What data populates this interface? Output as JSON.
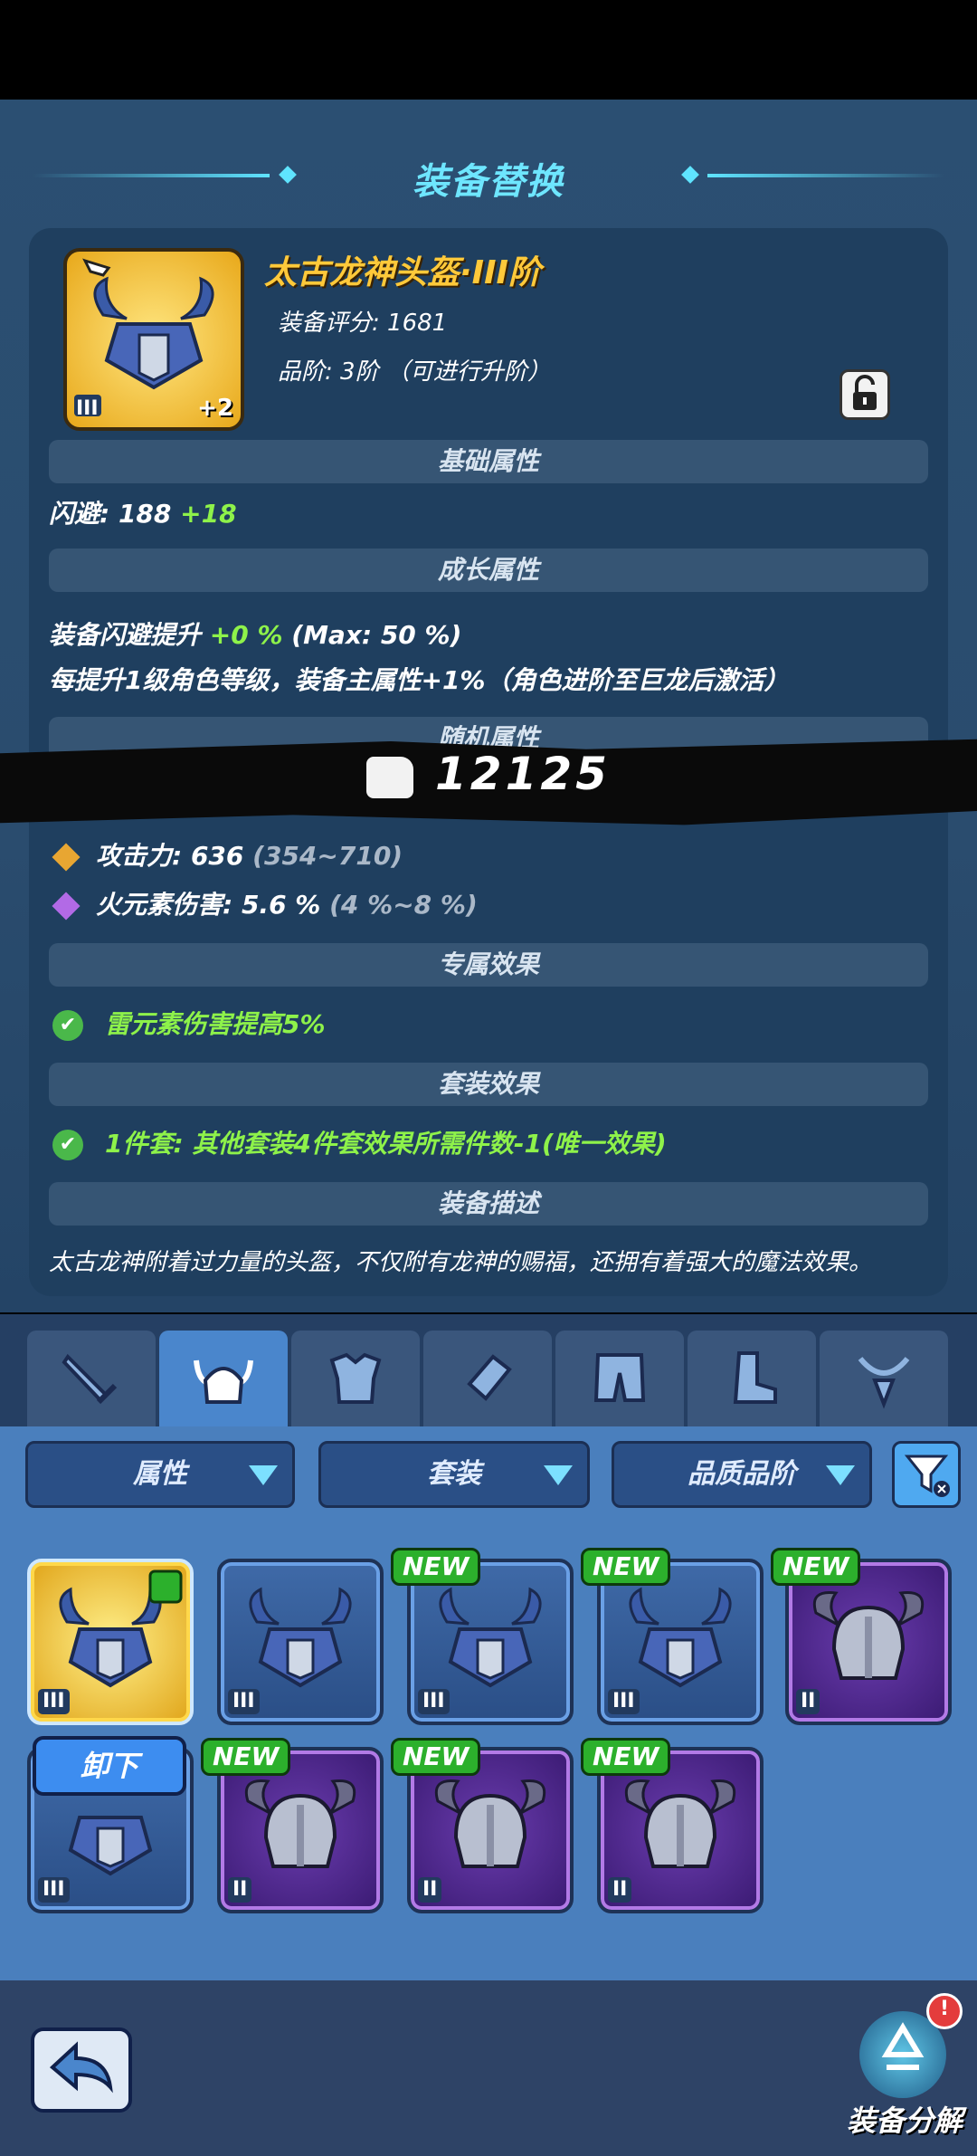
{
  "header": {
    "title": "装备替换"
  },
  "item": {
    "name": "太古龙神头盔·III阶",
    "score": "装备评分: 1681",
    "grade": "品阶: 3阶 （可进行升阶）",
    "tier": "III",
    "plus": "+2"
  },
  "sections": {
    "base": "基础属性",
    "growth": "成长属性",
    "random": "随机属性",
    "exclusive": "专属效果",
    "set": "套装效果",
    "desc": "装备描述"
  },
  "stats": {
    "dodge_label": "闪避: 188",
    "dodge_bonus": "+18",
    "growth_line1_a": "装备闪避提升",
    "growth_line1_b": "+0 %",
    "growth_line1_c": "(Max: 50 %)",
    "growth_line2": "每提升1级角色等级，装备主属性+1%（角色进阶至巨龙后激活）",
    "attack": "攻击力: 636",
    "attack_range": "(354~710)",
    "fire": "火元素伤害: 5.6 %",
    "fire_range": "(4 %~8 %)",
    "exclusive_effect": "雷元素伤害提高5%",
    "set_effect": "1件套: 其他套装4件套效果所需件数-1(唯一效果)",
    "description": "太古龙神附着过力量的头盔，不仅附有龙神的赐福，还拥有着强大的魔法效果。"
  },
  "power": "12125",
  "filters": [
    "属性",
    "套装",
    "品质品阶"
  ],
  "tabs": [
    "weapon",
    "helmet",
    "armor",
    "bracer",
    "pants",
    "boots",
    "necklace"
  ],
  "inventory": [
    {
      "tier": "III",
      "rarity": "gold",
      "new": false,
      "equipped": true
    },
    {
      "tier": "III",
      "rarity": "blue",
      "new": false
    },
    {
      "tier": "III",
      "rarity": "blue",
      "new": true
    },
    {
      "tier": "III",
      "rarity": "blue",
      "new": true
    },
    {
      "tier": "II",
      "rarity": "purple",
      "new": true
    },
    {
      "tier": "III",
      "rarity": "blue",
      "new": false
    },
    {
      "tier": "II",
      "rarity": "purple",
      "new": true
    },
    {
      "tier": "II",
      "rarity": "purple",
      "new": true
    },
    {
      "tier": "II",
      "rarity": "purple",
      "new": true
    }
  ],
  "labels": {
    "new": "NEW",
    "unequip": "卸下",
    "decompose": "装备分解",
    "badge": "!"
  }
}
